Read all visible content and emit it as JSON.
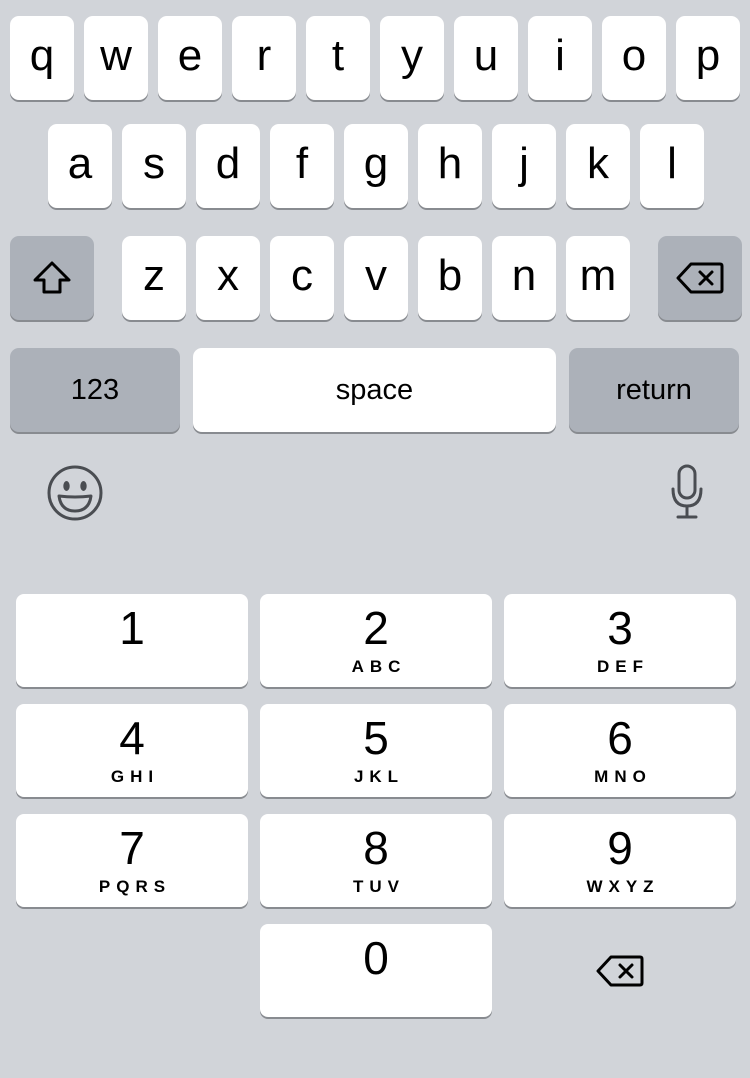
{
  "keyboard": {
    "row1": [
      "q",
      "w",
      "e",
      "r",
      "t",
      "y",
      "u",
      "i",
      "o",
      "p"
    ],
    "row2": [
      "a",
      "s",
      "d",
      "f",
      "g",
      "h",
      "j",
      "k",
      "l"
    ],
    "row3": [
      "z",
      "x",
      "c",
      "v",
      "b",
      "n",
      "m"
    ],
    "numbers_label": "123",
    "space_label": "space",
    "return_label": "return",
    "icons": {
      "shift": "shift-arrow-icon",
      "delete": "backspace-icon",
      "emoji": "smiley-face-icon",
      "dictation": "microphone-icon"
    },
    "colors": {
      "background": "#d1d4d9",
      "key": "#ffffff",
      "special_key": "#acb1b9"
    }
  },
  "numpad": {
    "keys": [
      {
        "digit": "1",
        "letters": ""
      },
      {
        "digit": "2",
        "letters": "ABC"
      },
      {
        "digit": "3",
        "letters": "DEF"
      },
      {
        "digit": "4",
        "letters": "GHI"
      },
      {
        "digit": "5",
        "letters": "JKL"
      },
      {
        "digit": "6",
        "letters": "MNO"
      },
      {
        "digit": "7",
        "letters": "PQRS"
      },
      {
        "digit": "8",
        "letters": "TUV"
      },
      {
        "digit": "9",
        "letters": "WXYZ"
      },
      {
        "digit": "0",
        "letters": ""
      }
    ],
    "delete_icon": "backspace-icon"
  }
}
